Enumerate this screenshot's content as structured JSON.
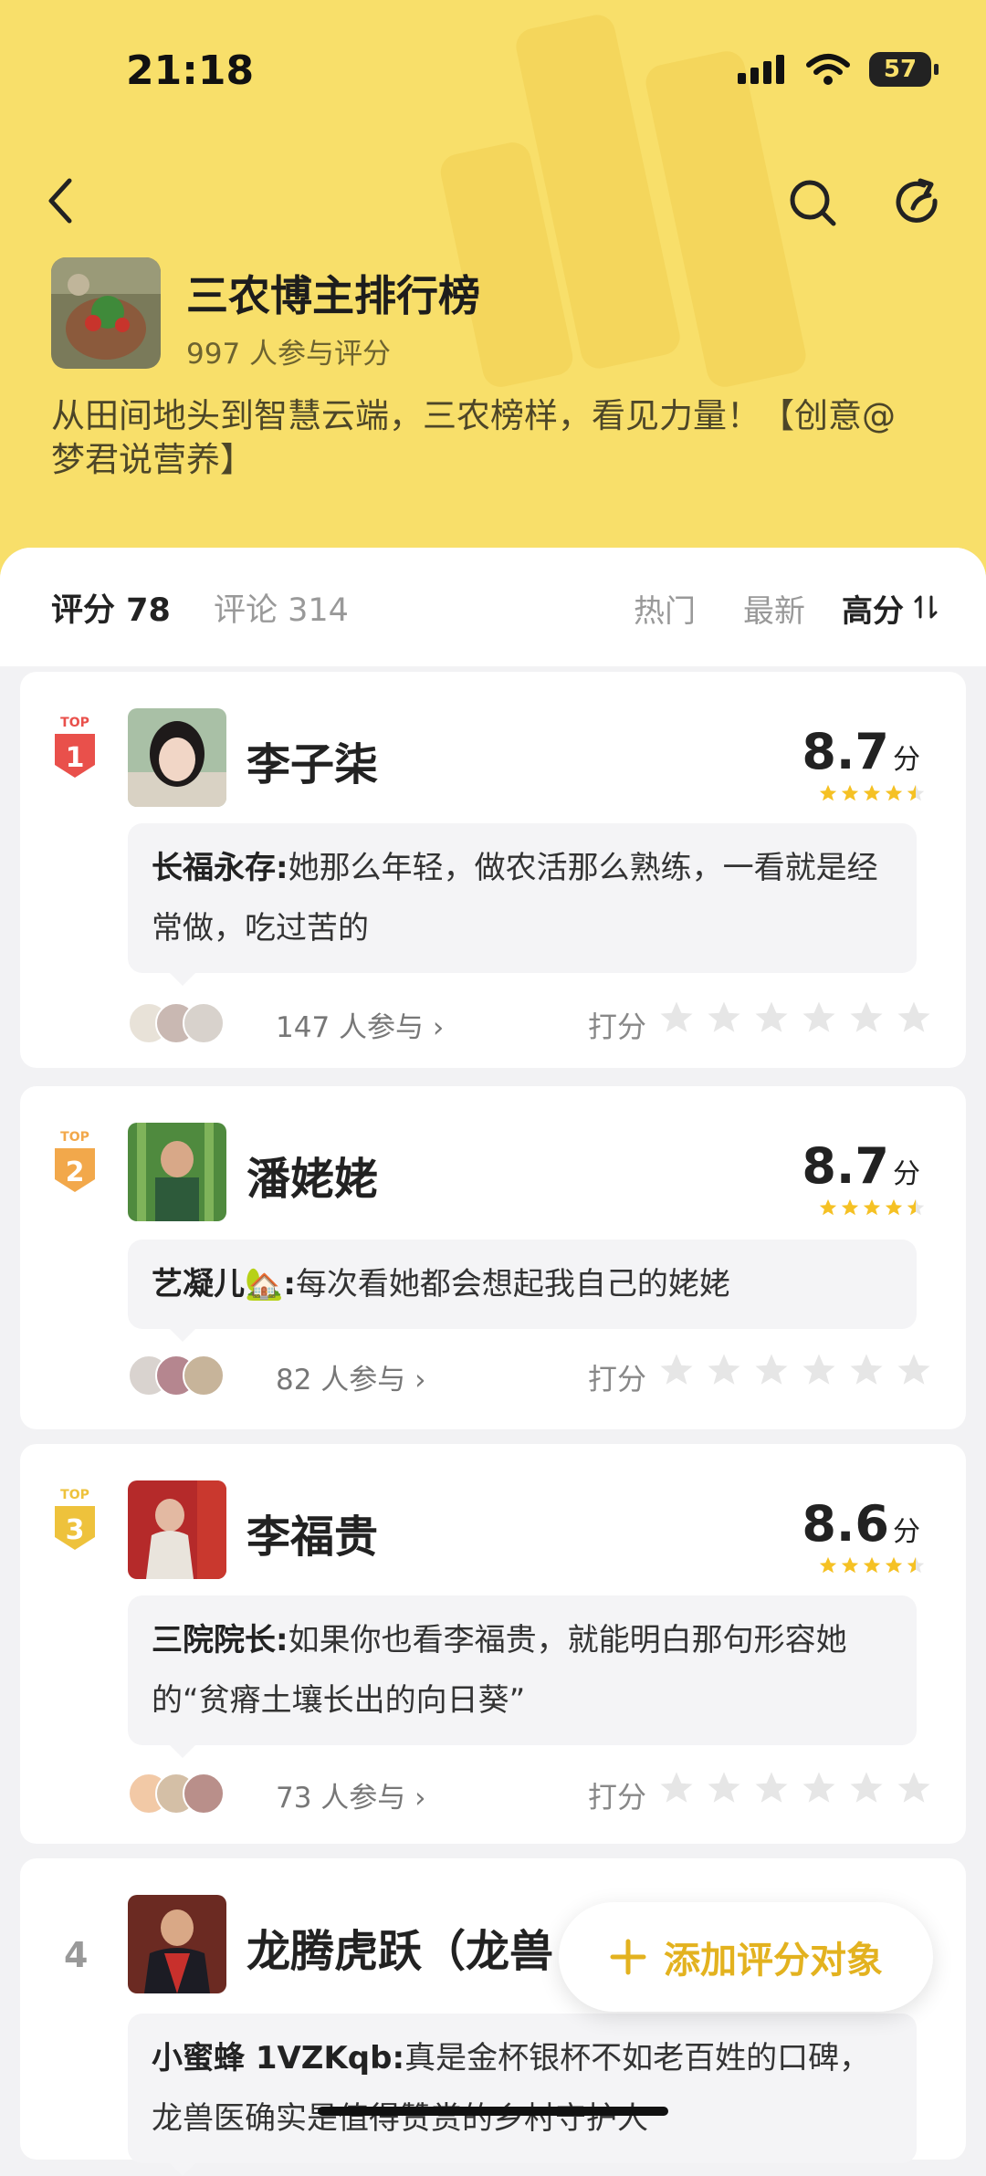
{
  "status": {
    "time": "21:18",
    "battery": "57"
  },
  "header": {
    "title": "三农博主排行榜",
    "participants": "997 人参与评分",
    "description": "从田间地头到智慧云端，三农榜样，看见力量！【创意@梦君说营养】"
  },
  "tabs": {
    "rating": "评分 78",
    "comments": "评论 314",
    "sort_hot": "热门",
    "sort_new": "最新",
    "sort_high": "高分"
  },
  "rank_label": "TOP",
  "rate_label": "打分",
  "score_unit": "分",
  "items": [
    {
      "rank": "1",
      "name": "李子柒",
      "score": "8.7",
      "comment_author": "长福永存:",
      "comment_text": "她那么年轻，做农活那么熟练，一看就是经常做，吃过苦的",
      "participants": "147 人参与 ›"
    },
    {
      "rank": "2",
      "name": "潘姥姥",
      "score": "8.7",
      "comment_author": "艺凝儿🏡:",
      "comment_text": "每次看她都会想起我自己的姥姥",
      "participants": "82 人参与 ›"
    },
    {
      "rank": "3",
      "name": "李福贵",
      "score": "8.6",
      "comment_author": "三院院长:",
      "comment_text": "如果你也看李福贵，就能明白那句形容她的“贫瘠土壤长出的向日葵”",
      "participants": "73 人参与 ›"
    },
    {
      "rank": "4",
      "name": "龙腾虎跃（龙兽",
      "comment_author": "小蜜蜂 1VZKqb:",
      "comment_text": "真是金杯银杯不如老百姓的口碑，龙兽医确实是值得赞赏的乡村守护人"
    }
  ],
  "fab": {
    "label": "添加评分对象"
  },
  "colors": {
    "header_bg": "#f8df6a",
    "accent": "#e3b21f",
    "rank1": "#e9504b",
    "rank2": "#f2a84b",
    "rank3": "#eec23c"
  }
}
